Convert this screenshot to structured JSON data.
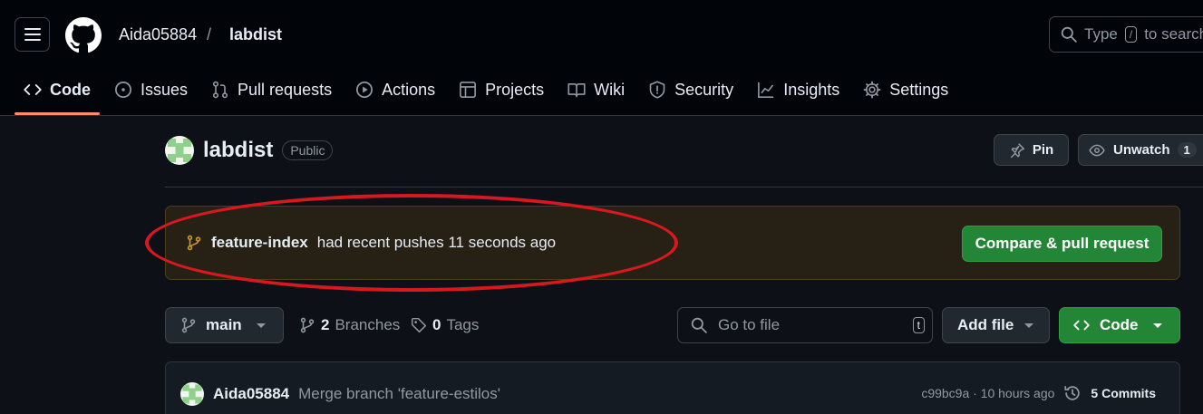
{
  "header": {
    "owner": "Aida05884",
    "separator": "/",
    "repo": "labdist",
    "search_placeholder_prefix": "Type",
    "search_key": "/",
    "search_placeholder_suffix": "to search"
  },
  "tabs": [
    {
      "label": "Code",
      "icon": "code-icon"
    },
    {
      "label": "Issues",
      "icon": "issue-icon"
    },
    {
      "label": "Pull requests",
      "icon": "pull-request-icon"
    },
    {
      "label": "Actions",
      "icon": "play-icon"
    },
    {
      "label": "Projects",
      "icon": "table-icon"
    },
    {
      "label": "Wiki",
      "icon": "book-icon"
    },
    {
      "label": "Security",
      "icon": "shield-icon"
    },
    {
      "label": "Insights",
      "icon": "graph-icon"
    },
    {
      "label": "Settings",
      "icon": "gear-icon"
    }
  ],
  "repo": {
    "name": "labdist",
    "visibility": "Public",
    "pin_label": "Pin",
    "watch_label": "Unwatch",
    "watch_count": "1"
  },
  "banner": {
    "branch": "feature-index",
    "text": "had recent pushes 11 seconds ago",
    "button": "Compare & pull request"
  },
  "toolbar": {
    "branch": "main",
    "branches_count": "2",
    "branches_label": "Branches",
    "tags_count": "0",
    "tags_label": "Tags",
    "goto_placeholder": "Go to file",
    "goto_key": "t",
    "add_file": "Add file",
    "code": "Code"
  },
  "commit": {
    "author": "Aida05884",
    "message": "Merge branch 'feature-estilos'",
    "hash_time": "c99bc9a · 10 hours ago",
    "commits_label": "5 Commits"
  },
  "colors": {
    "accent_orange": "#fd8c73",
    "green": "#238636",
    "annotation_red": "#d8181f"
  }
}
